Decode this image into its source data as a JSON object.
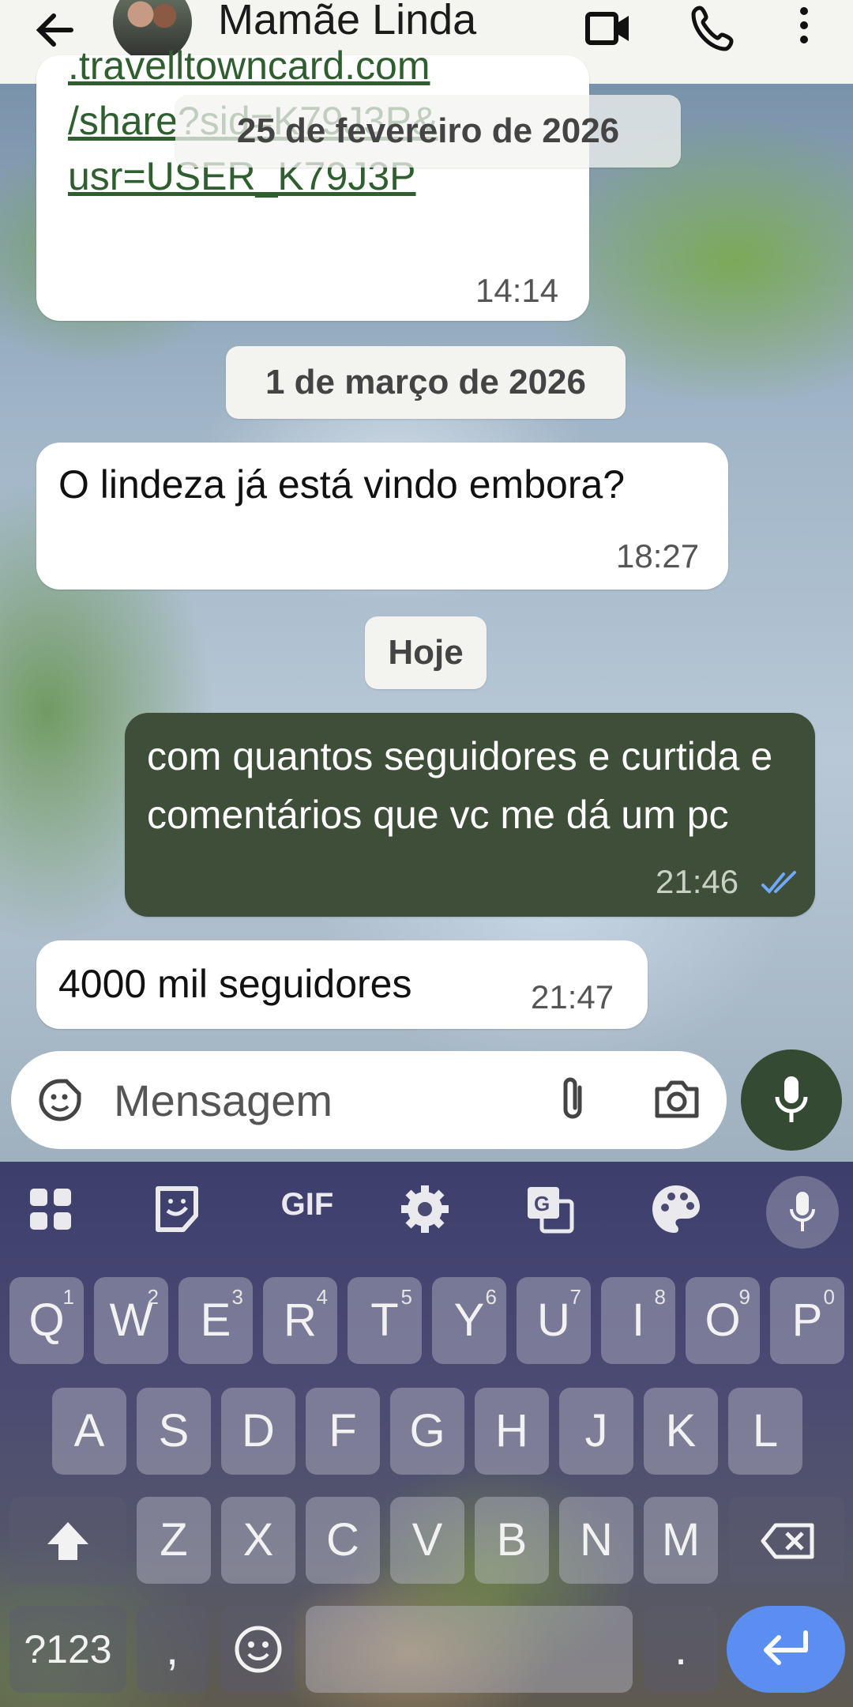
{
  "header": {
    "back_icon": "arrow-left-icon",
    "contact_name": "Mamãe Linda",
    "video_icon": "video-camera-icon",
    "call_icon": "phone-icon",
    "menu_icon": "more-vertical-icon"
  },
  "messages": [
    {
      "id": "link-msg",
      "direction": "incoming",
      "lines": [
        ".travelltowncard.com",
        "/share?sid=K79J3P&",
        "usr=USER_K79J3P"
      ],
      "time": "14:14"
    },
    {
      "id": "q-msg",
      "direction": "incoming",
      "text": "O lindeza já está vindo embora?",
      "time": "18:27"
    },
    {
      "id": "out-msg",
      "direction": "outgoing",
      "text": "com quantos seguidores e curtida e comentários que vc me dá um pc",
      "time": "21:46",
      "status_icon": "double-check-icon"
    },
    {
      "id": "ans-msg",
      "direction": "incoming",
      "text": "4000 mil seguidores",
      "time": "21:47"
    }
  ],
  "date_chips": {
    "floating": "25 de fevereiro de 2026",
    "march": "1 de março de 2026",
    "today": "Hoje"
  },
  "composer": {
    "placeholder": "Mensagem",
    "emoji_icon": "sticker-smiley-icon",
    "attach_icon": "paperclip-icon",
    "camera_icon": "camera-icon",
    "mic_icon": "microphone-icon"
  },
  "keyboard": {
    "toolbar": [
      "apps-grid-icon",
      "sticker-icon",
      "GIF",
      "settings-gear-icon",
      "translate-icon",
      "palette-icon",
      "microphone-icon"
    ],
    "row1": [
      [
        "Q",
        "1"
      ],
      [
        "W",
        "2"
      ],
      [
        "E",
        "3"
      ],
      [
        "R",
        "4"
      ],
      [
        "T",
        "5"
      ],
      [
        "Y",
        "6"
      ],
      [
        "U",
        "7"
      ],
      [
        "I",
        "8"
      ],
      [
        "O",
        "9"
      ],
      [
        "P",
        "0"
      ]
    ],
    "row2": [
      "A",
      "S",
      "D",
      "F",
      "G",
      "H",
      "J",
      "K",
      "L"
    ],
    "row3": [
      "Z",
      "X",
      "C",
      "V",
      "B",
      "N",
      "M"
    ],
    "shift_icon": "shift-arrow-icon",
    "backspace_icon": "backspace-icon",
    "symbols_key": "?123",
    "comma_key": ",",
    "emoji_icon": "smiley-icon",
    "period_key": ".",
    "enter_icon": "enter-arrow-icon"
  },
  "colors": {
    "outgoing_bubble": "#3e4e39",
    "mic_fab": "#354a33",
    "enter_key": "#5b8ef0",
    "read_check": "#6fa8ff"
  }
}
